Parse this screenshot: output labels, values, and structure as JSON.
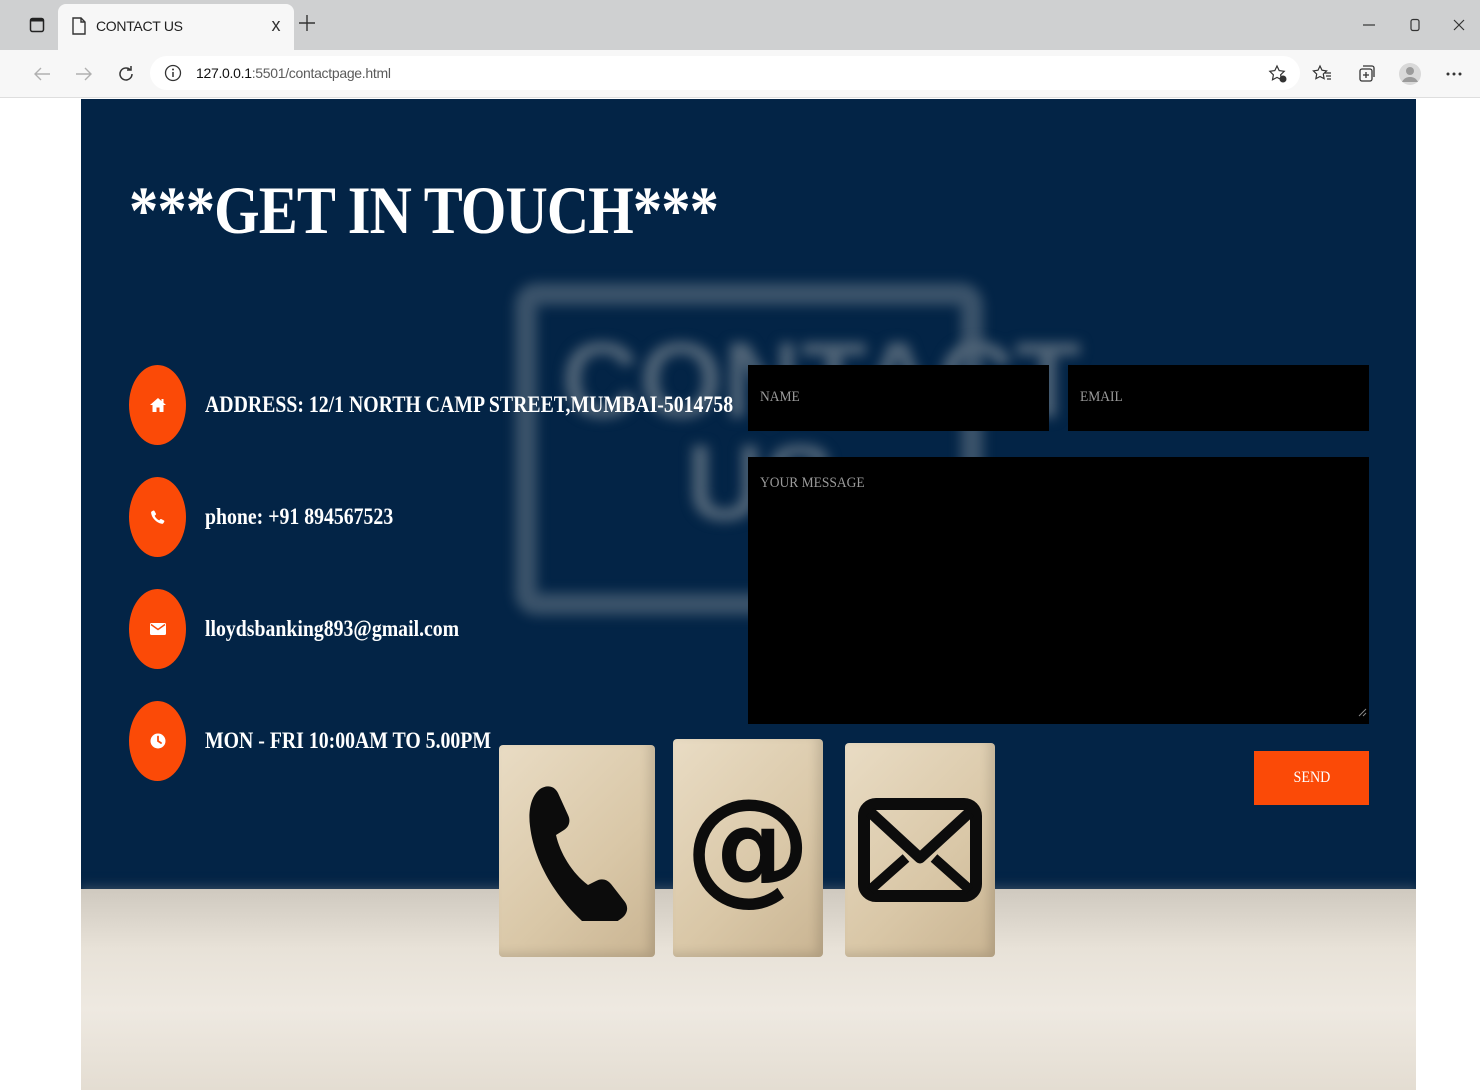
{
  "browser": {
    "tab_title": "CONTACT US",
    "tab_close": "x",
    "url_host": "127.0.0.1",
    "url_rest": ":5501/contactpage.html"
  },
  "page": {
    "title": "***GET IN TOUCH***",
    "contacts": [
      {
        "icon": "home-icon",
        "text": "ADDRESS: 12/1 NORTH CAMP STREET,MUMBAI-5014758"
      },
      {
        "icon": "phone-icon",
        "text": "phone: +91 894567523"
      },
      {
        "icon": "envelope-icon",
        "text": "lloydsbanking893@gmail.com"
      },
      {
        "icon": "clock-icon",
        "text": "MON - FRI 10:00AM TO 5.00PM"
      }
    ],
    "form": {
      "name_placeholder": "NAME",
      "email_placeholder": "EMAIL",
      "message_placeholder": "YOUR MESSAGE",
      "send_label": "SEND"
    },
    "background_sign": "CONTACT US"
  },
  "colors": {
    "page_background": "#032446",
    "accent": "#fb4a07",
    "field_background": "#000000"
  }
}
